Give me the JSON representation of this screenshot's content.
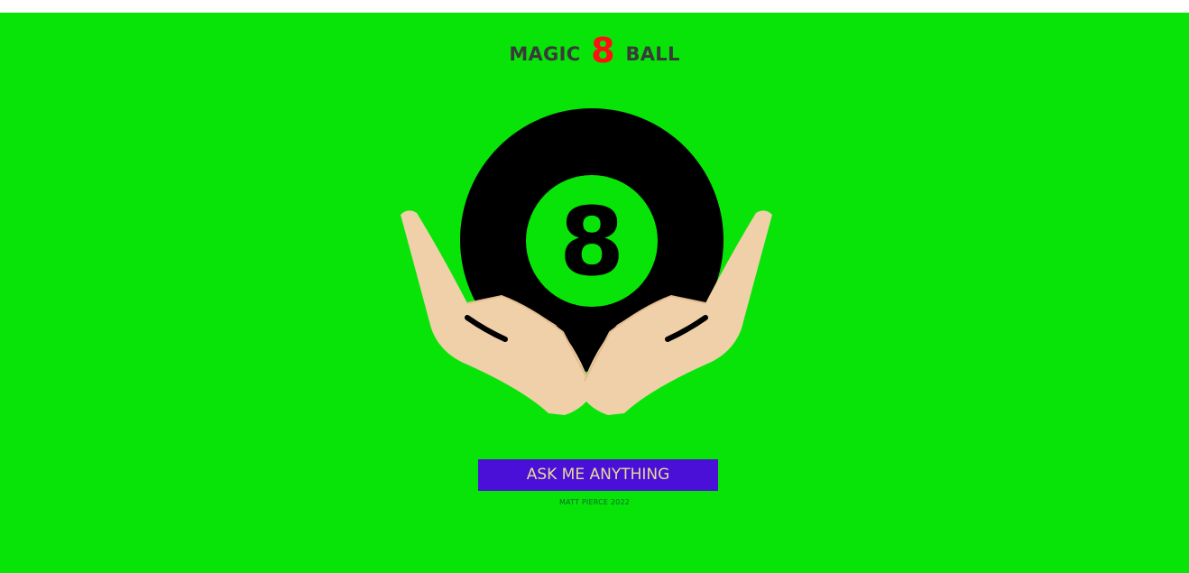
{
  "header": {
    "title_prefix": "MAGIC",
    "title_number": "8",
    "title_suffix": "BALL"
  },
  "ball": {
    "number": "8"
  },
  "actions": {
    "ask_label": "ASK ME ANYTHING"
  },
  "footer": {
    "credit": "MATT PIERCE 2022"
  },
  "colors": {
    "background": "#08e408",
    "title_text": "#3a3a3a",
    "title_number": "#ff1010",
    "ball": "#000000",
    "hands": "#f0d0a8",
    "button": "#4b10d8",
    "button_text": "#e8d89a"
  },
  "icons": {
    "topbar": "partial-logo-icon",
    "main": "magic-8-ball-in-hands-illustration"
  }
}
